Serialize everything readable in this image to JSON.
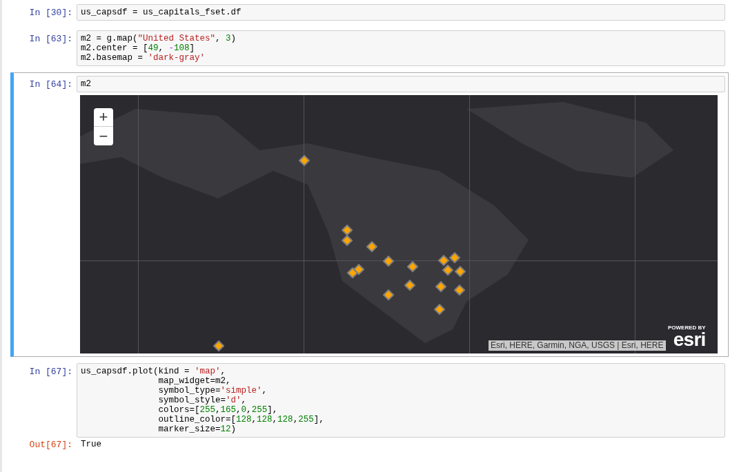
{
  "cells": [
    {
      "prompt": "In [30]:",
      "selected": false,
      "code": [
        [
          {
            "kind": "plain",
            "text": "us_capsdf = us_capitals_fset.df"
          }
        ]
      ]
    },
    {
      "prompt": "In [63]:",
      "selected": false,
      "code": [
        [
          {
            "kind": "plain",
            "text": "m2 = g.map("
          },
          {
            "kind": "string",
            "text": "\"United States\""
          },
          {
            "kind": "plain",
            "text": ", "
          },
          {
            "kind": "number",
            "text": "3"
          },
          {
            "kind": "plain",
            "text": ")"
          }
        ],
        [
          {
            "kind": "plain",
            "text": "m2.center = ["
          },
          {
            "kind": "number",
            "text": "49"
          },
          {
            "kind": "plain",
            "text": ", "
          },
          {
            "kind": "op",
            "text": "-"
          },
          {
            "kind": "number",
            "text": "108"
          },
          {
            "kind": "plain",
            "text": "]"
          }
        ],
        [
          {
            "kind": "plain",
            "text": "m2.basemap = "
          },
          {
            "kind": "string",
            "text": "'dark-gray'"
          }
        ]
      ]
    },
    {
      "prompt": "In [64]:",
      "selected": true,
      "code": [
        [
          {
            "kind": "plain",
            "text": "m2"
          }
        ]
      ],
      "map": {
        "zoom_in": "+",
        "zoom_out": "−",
        "attribution": "Esri, HERE, Garmin, NGA, USGS | Esri, HERE",
        "logo_caption": "POWERED BY",
        "logo": "esri"
      }
    },
    {
      "prompt": "In [67]:",
      "selected": false,
      "code": [
        [
          {
            "kind": "plain",
            "text": "us_capsdf.plot(kind = "
          },
          {
            "kind": "string",
            "text": "'map'"
          },
          {
            "kind": "plain",
            "text": ","
          }
        ],
        [
          {
            "kind": "plain",
            "text": "               map_widget=m2,"
          }
        ],
        [
          {
            "kind": "plain",
            "text": "               symbol_type="
          },
          {
            "kind": "string",
            "text": "'simple'"
          },
          {
            "kind": "plain",
            "text": ","
          }
        ],
        [
          {
            "kind": "plain",
            "text": "               symbol_style="
          },
          {
            "kind": "string",
            "text": "'d'"
          },
          {
            "kind": "plain",
            "text": ","
          }
        ],
        [
          {
            "kind": "plain",
            "text": "               colors=["
          },
          {
            "kind": "number",
            "text": "255"
          },
          {
            "kind": "plain",
            "text": ","
          },
          {
            "kind": "number",
            "text": "165"
          },
          {
            "kind": "plain",
            "text": ","
          },
          {
            "kind": "number",
            "text": "0"
          },
          {
            "kind": "plain",
            "text": ","
          },
          {
            "kind": "number",
            "text": "255"
          },
          {
            "kind": "plain",
            "text": "],"
          }
        ],
        [
          {
            "kind": "plain",
            "text": "               outline_color=["
          },
          {
            "kind": "number",
            "text": "128"
          },
          {
            "kind": "plain",
            "text": ","
          },
          {
            "kind": "number",
            "text": "128"
          },
          {
            "kind": "plain",
            "text": ","
          },
          {
            "kind": "number",
            "text": "128"
          },
          {
            "kind": "plain",
            "text": ","
          },
          {
            "kind": "number",
            "text": "255"
          },
          {
            "kind": "plain",
            "text": "],"
          }
        ],
        [
          {
            "kind": "plain",
            "text": "               marker_size="
          },
          {
            "kind": "number",
            "text": "12"
          },
          {
            "kind": "plain",
            "text": ")"
          }
        ]
      ],
      "output": {
        "prompt": "Out[67]:",
        "text": "True"
      }
    }
  ]
}
